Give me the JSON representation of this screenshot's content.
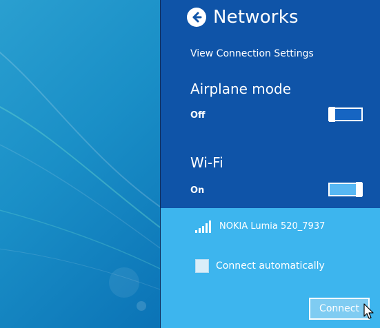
{
  "panel": {
    "title": "Networks",
    "view_settings_link": "View Connection Settings",
    "airplane": {
      "label": "Airplane mode",
      "status": "Off",
      "enabled": false
    },
    "wifi": {
      "label": "Wi-Fi",
      "status": "On",
      "enabled": true
    },
    "network": {
      "name": "NOKIA Lumia 520_7937",
      "signal_icon": "signal-bars-icon"
    },
    "connect_automatically": {
      "label": "Connect automatically",
      "checked": false
    },
    "connect_button": "Connect"
  },
  "colors": {
    "panel_top": "#0f54a8",
    "panel_bottom": "#3db5ee",
    "desktop": "#1a8fc7"
  }
}
